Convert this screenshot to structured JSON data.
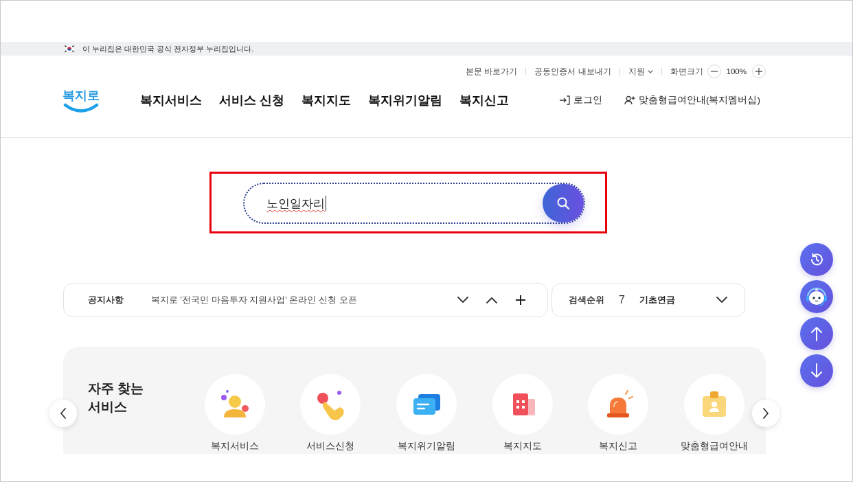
{
  "gov_banner": {
    "text": "이 누리집은 대한민국 공식 전자정부 누리집입니다."
  },
  "header": {
    "logo": "복지로",
    "utility_links": [
      {
        "kind": "link",
        "label": "본문 바로가기"
      },
      {
        "kind": "link",
        "label": "공동인증서 내보내기"
      },
      {
        "kind": "dropdown",
        "label": "지원"
      }
    ],
    "zoom": {
      "label": "화면크기",
      "value": "100%"
    },
    "nav": [
      "복지서비스",
      "서비스 신청",
      "복지지도",
      "복지위기알림",
      "복지신고"
    ],
    "actions": [
      {
        "kind": "login",
        "label": "로그인"
      },
      {
        "kind": "membership",
        "label": "맞춤형급여안내(복지멤버십)"
      }
    ]
  },
  "search": {
    "value": "노인일자리",
    "spell_error": true,
    "highlighted": true
  },
  "notice": {
    "label": "공지사항",
    "text": "복지로 '전국민 마음투자 지원사업' 온라인 신청 오픈"
  },
  "search_ranking": {
    "label": "검색순위",
    "rank": "7",
    "keyword": "기초연금"
  },
  "frequent_services": {
    "title": "자주 찾는 서비스",
    "items": [
      {
        "kind": "person",
        "label": "복지서비스"
      },
      {
        "kind": "pointing-hand",
        "label": "서비스신청"
      },
      {
        "kind": "message",
        "label": "복지위기알림"
      },
      {
        "kind": "building",
        "label": "복지지도"
      },
      {
        "kind": "siren",
        "label": "복지신고"
      },
      {
        "kind": "id-card",
        "label": "맞춤형급여안내"
      }
    ]
  }
}
